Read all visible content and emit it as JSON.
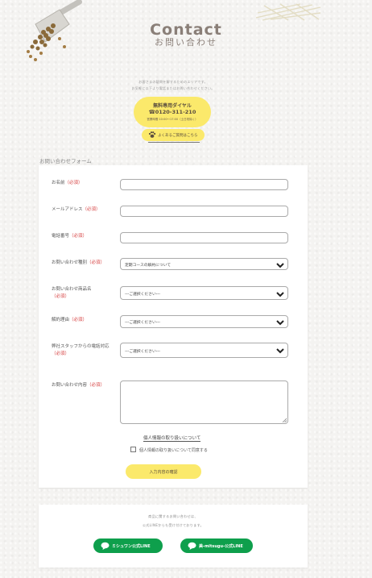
{
  "header": {
    "title": "Contact",
    "subtitle": "お問い合わせ",
    "intro_line1": "お客さまの疑問を解するためのエリアです。",
    "intro_line2": "お気軽に以下より電話またはお問い合わせください。"
  },
  "dial": {
    "label": "無料専用ダイヤル",
    "number": "☎0120-311-210",
    "hours": "営業時間 10:00〜17:00（土日祝除く）",
    "faq_button": "よくあるご質問はこちら"
  },
  "form": {
    "section_title": "お問い合わせフォーム",
    "required_tag": "（必須）",
    "fields": [
      {
        "label": "お名前",
        "type": "text",
        "value": ""
      },
      {
        "label": "メールアドレス",
        "type": "text",
        "value": ""
      },
      {
        "label": "電話番号",
        "type": "text",
        "value": ""
      },
      {
        "label": "お問い合わせ種別",
        "type": "select",
        "value": "定期コースの解約について"
      },
      {
        "label": "お問い合わせ商品名",
        "type": "select",
        "value": "---ご選択ください---"
      },
      {
        "label": "解約理由",
        "type": "select",
        "value": "---ご選択ください---"
      },
      {
        "label": "弊社スタッフからの電話対応",
        "type": "select",
        "value": "---ご選択ください---"
      },
      {
        "label": "お問い合わせ内容",
        "type": "textarea",
        "value": ""
      }
    ],
    "privacy_link": "個人情報の取り扱いについて",
    "agree_label": "個人情報の取り扱いについて同意する",
    "agree_checked": false,
    "confirm_button": "入力内容の確認"
  },
  "line_section": {
    "text1": "商品に関するお問い合わせは、",
    "text2": "公式LINEからも受け付けております。",
    "button1": "ミシュワン公式LINE",
    "button2": "美-mitsugu-公式LINE"
  },
  "colors": {
    "accent_yellow": "#fbe96b",
    "line_green": "#0e9f4c",
    "required_red": "#d64040"
  },
  "icons": [
    "food-scoop-icon",
    "phone-icon",
    "paw-icon",
    "chevron-down-icon",
    "line-chat-icon"
  ]
}
